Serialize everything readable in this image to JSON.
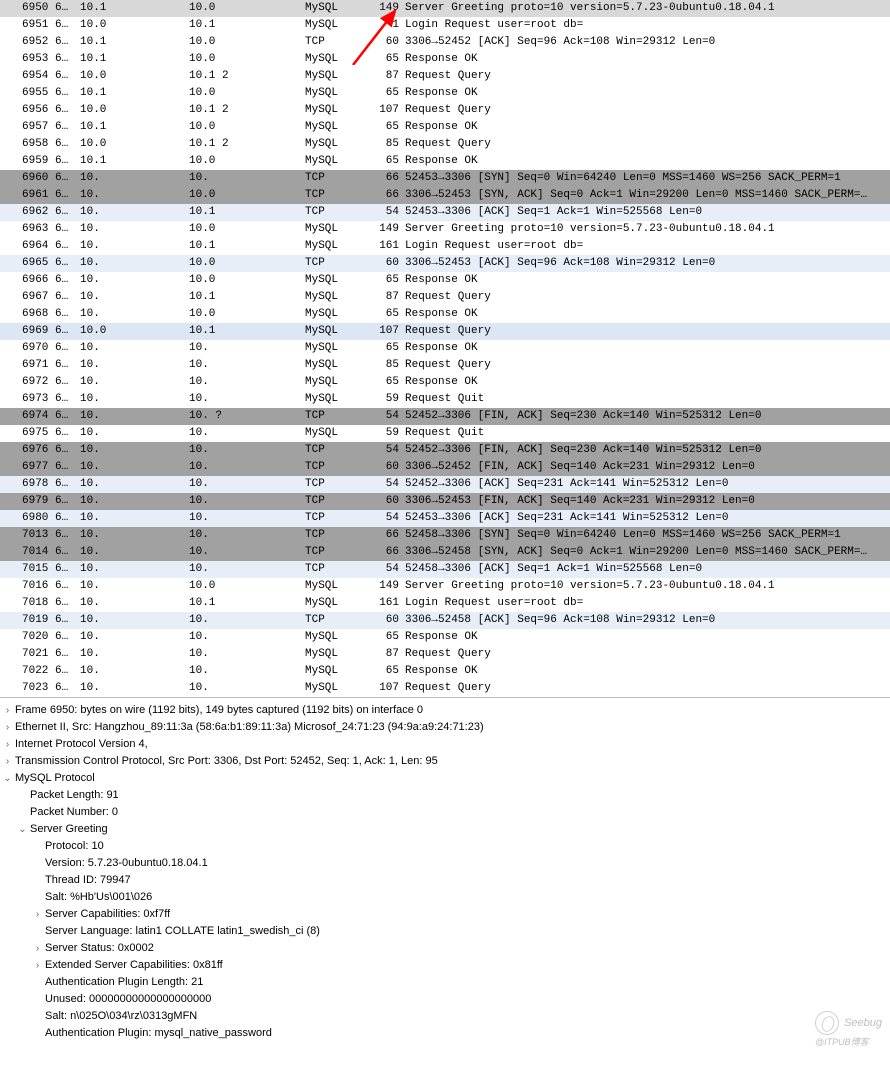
{
  "packets": [
    {
      "no": "6950",
      "time": "6…",
      "src": "10.1",
      "dst": "10.0",
      "proto": "MySQL",
      "len": "149",
      "info": "Server Greeting proto=10 version=5.7.23-0ubuntu0.18.04.1",
      "bg": "bg-sel"
    },
    {
      "no": "6951",
      "time": "6…",
      "src": "10.0",
      "dst": "10.1",
      "proto": "MySQL",
      "len": "  1",
      "info": "Login Request user=root db=",
      "bg": "bg-white"
    },
    {
      "no": "6952",
      "time": "6…",
      "src": "10.1",
      "dst": "10.0",
      "proto": "TCP",
      "len": "60",
      "info": "3306→52452 [ACK] Seq=96 Ack=108 Win=29312 Len=0",
      "bg": "bg-white"
    },
    {
      "no": "6953",
      "time": "6…",
      "src": "10.1",
      "dst": "10.0",
      "proto": "MySQL",
      "len": "65",
      "info": "Response OK",
      "bg": "bg-white"
    },
    {
      "no": "6954",
      "time": "6…",
      "src": "10.0",
      "dst": "10.1    2",
      "proto": "MySQL",
      "len": "87",
      "info": "Request Query",
      "bg": "bg-white"
    },
    {
      "no": "6955",
      "time": "6…",
      "src": "10.1",
      "dst": "10.0",
      "proto": "MySQL",
      "len": "65",
      "info": "Response OK",
      "bg": "bg-white"
    },
    {
      "no": "6956",
      "time": "6…",
      "src": "10.0",
      "dst": "10.1    2",
      "proto": "MySQL",
      "len": "107",
      "info": "Request Query",
      "bg": "bg-white"
    },
    {
      "no": "6957",
      "time": "6…",
      "src": "10.1",
      "dst": "10.0",
      "proto": "MySQL",
      "len": "65",
      "info": "Response OK",
      "bg": "bg-white"
    },
    {
      "no": "6958",
      "time": "6…",
      "src": "10.0",
      "dst": "10.1    2",
      "proto": "MySQL",
      "len": "85",
      "info": "Request Query",
      "bg": "bg-white"
    },
    {
      "no": "6959",
      "time": "6…",
      "src": "10.1",
      "dst": "10.0",
      "proto": "MySQL",
      "len": "65",
      "info": "Response OK",
      "bg": "bg-white"
    },
    {
      "no": "6960",
      "time": "6…",
      "src": "10.",
      "dst": "10.",
      "proto": "TCP",
      "len": "66",
      "info": "52453→3306 [SYN] Seq=0 Win=64240 Len=0 MSS=1460 WS=256 SACK_PERM=1",
      "bg": "bg-dark"
    },
    {
      "no": "6961",
      "time": "6…",
      "src": "10.",
      "dst": "10.0",
      "proto": "TCP",
      "len": "66",
      "info": "3306→52453 [SYN, ACK] Seq=0 Ack=1 Win=29200 Len=0 MSS=1460 SACK_PERM=…",
      "bg": "bg-dark"
    },
    {
      "no": "6962",
      "time": "6…",
      "src": "10.",
      "dst": "10.1",
      "proto": "TCP",
      "len": "54",
      "info": "52453→3306 [ACK] Seq=1 Ack=1 Win=525568 Len=0",
      "bg": "bg-light1"
    },
    {
      "no": "6963",
      "time": "6…",
      "src": "10.",
      "dst": "10.0",
      "proto": "MySQL",
      "len": "149",
      "info": "Server Greeting proto=10 version=5.7.23-0ubuntu0.18.04.1",
      "bg": "bg-white"
    },
    {
      "no": "6964",
      "time": "6…",
      "src": "10.",
      "dst": "10.1",
      "proto": "MySQL",
      "len": "161",
      "info": "Login Request user=root db=",
      "bg": "bg-white"
    },
    {
      "no": "6965",
      "time": "6…",
      "src": "10.",
      "dst": "10.0",
      "proto": "TCP",
      "len": "60",
      "info": "3306→52453 [ACK] Seq=96 Ack=108 Win=29312 Len=0",
      "bg": "bg-light1"
    },
    {
      "no": "6966",
      "time": "6…",
      "src": "10.",
      "dst": "10.0",
      "proto": "MySQL",
      "len": "65",
      "info": "Response OK",
      "bg": "bg-white"
    },
    {
      "no": "6967",
      "time": "6…",
      "src": "10.",
      "dst": "10.1",
      "proto": "MySQL",
      "len": "87",
      "info": "Request Query",
      "bg": "bg-white"
    },
    {
      "no": "6968",
      "time": "6…",
      "src": "10.",
      "dst": "10.0",
      "proto": "MySQL",
      "len": "65",
      "info": "Response OK",
      "bg": "bg-white"
    },
    {
      "no": "6969",
      "time": "6…",
      "src": "10.0",
      "dst": "10.1",
      "proto": "MySQL",
      "len": "107",
      "info": "Request Query",
      "bg": "bg-light2"
    },
    {
      "no": "6970",
      "time": "6…",
      "src": "10.",
      "dst": "10.",
      "proto": "MySQL",
      "len": "65",
      "info": "Response OK",
      "bg": "bg-white"
    },
    {
      "no": "6971",
      "time": "6…",
      "src": "10.",
      "dst": "10.",
      "proto": "MySQL",
      "len": "85",
      "info": "Request Query",
      "bg": "bg-white"
    },
    {
      "no": "6972",
      "time": "6…",
      "src": "10.",
      "dst": "10.",
      "proto": "MySQL",
      "len": "65",
      "info": "Response OK",
      "bg": "bg-white"
    },
    {
      "no": "6973",
      "time": "6…",
      "src": "10.",
      "dst": "10.",
      "proto": "MySQL",
      "len": "59",
      "info": "Request Quit",
      "bg": "bg-white"
    },
    {
      "no": "6974",
      "time": "6…",
      "src": "10.",
      "dst": "10.      ?",
      "proto": "TCP",
      "len": "54",
      "info": "52452→3306 [FIN, ACK] Seq=230 Ack=140 Win=525312 Len=0",
      "bg": "bg-dark"
    },
    {
      "no": "6975",
      "time": "6…",
      "src": "10.",
      "dst": "10.",
      "proto": "MySQL",
      "len": "59",
      "info": "Request Quit",
      "bg": "bg-white"
    },
    {
      "no": "6976",
      "time": "6…",
      "src": "10.",
      "dst": "10.",
      "proto": "TCP",
      "len": "54",
      "info": "52452→3306 [FIN, ACK] Seq=230 Ack=140 Win=525312 Len=0",
      "bg": "bg-dark"
    },
    {
      "no": "6977",
      "time": "6…",
      "src": "10.",
      "dst": "10.",
      "proto": "TCP",
      "len": "60",
      "info": "3306→52452 [FIN, ACK] Seq=140 Ack=231 Win=29312 Len=0",
      "bg": "bg-dark"
    },
    {
      "no": "6978",
      "time": "6…",
      "src": "10.",
      "dst": "10.",
      "proto": "TCP",
      "len": "54",
      "info": "52452→3306 [ACK] Seq=231 Ack=141 Win=525312 Len=0",
      "bg": "bg-light1"
    },
    {
      "no": "6979",
      "time": "6…",
      "src": "10.",
      "dst": "10.",
      "proto": "TCP",
      "len": "60",
      "info": "3306→52453 [FIN, ACK] Seq=140 Ack=231 Win=29312 Len=0",
      "bg": "bg-dark"
    },
    {
      "no": "6980",
      "time": "6…",
      "src": "10.",
      "dst": "10.",
      "proto": "TCP",
      "len": "54",
      "info": "52453→3306 [ACK] Seq=231 Ack=141 Win=525312 Len=0",
      "bg": "bg-light1"
    },
    {
      "no": "7013",
      "time": "6…",
      "src": "10.",
      "dst": "10.",
      "proto": "TCP",
      "len": "66",
      "info": "52458→3306 [SYN] Seq=0 Win=64240 Len=0 MSS=1460 WS=256 SACK_PERM=1",
      "bg": "bg-dark"
    },
    {
      "no": "7014",
      "time": "6…",
      "src": "10.",
      "dst": "10.",
      "proto": "TCP",
      "len": "66",
      "info": "3306→52458 [SYN, ACK] Seq=0 Ack=1 Win=29200 Len=0 MSS=1460 SACK_PERM=…",
      "bg": "bg-dark"
    },
    {
      "no": "7015",
      "time": "6…",
      "src": "10.",
      "dst": "10.",
      "proto": "TCP",
      "len": "54",
      "info": "52458→3306 [ACK] Seq=1 Ack=1 Win=525568 Len=0",
      "bg": "bg-light1"
    },
    {
      "no": "7016",
      "time": "6…",
      "src": "10.",
      "dst": "10.0",
      "proto": "MySQL",
      "len": "149",
      "info": "Server Greeting proto=10 version=5.7.23-0ubuntu0.18.04.1",
      "bg": "bg-white"
    },
    {
      "no": "7018",
      "time": "6…",
      "src": "10.",
      "dst": "10.1",
      "proto": "MySQL",
      "len": "161",
      "info": "Login Request user=root db=",
      "bg": "bg-white"
    },
    {
      "no": "7019",
      "time": "6…",
      "src": "10.",
      "dst": "10.",
      "proto": "TCP",
      "len": "60",
      "info": "3306→52458 [ACK] Seq=96 Ack=108 Win=29312 Len=0",
      "bg": "bg-light1"
    },
    {
      "no": "7020",
      "time": "6…",
      "src": "10.",
      "dst": "10.",
      "proto": "MySQL",
      "len": "65",
      "info": "Response OK",
      "bg": "bg-white"
    },
    {
      "no": "7021",
      "time": "6…",
      "src": "10.",
      "dst": "10.",
      "proto": "MySQL",
      "len": "87",
      "info": "Request Query",
      "bg": "bg-white"
    },
    {
      "no": "7022",
      "time": "6…",
      "src": "10.",
      "dst": "10.",
      "proto": "MySQL",
      "len": "65",
      "info": "Response OK",
      "bg": "bg-white"
    },
    {
      "no": "7023",
      "time": "6…",
      "src": "10.",
      "dst": "10.",
      "proto": "MySQL",
      "len": "107",
      "info": "Request Query",
      "bg": "bg-white"
    }
  ],
  "details": {
    "frame": "Frame 6950:    bytes on wire (1192 bits), 149 bytes captured (1192 bits) on interface 0",
    "eth": "Ethernet II, Src: Hangzhou_89:11:3a (58:6a:b1:89:11:3a)      Microsof_24:71:23 (94:9a:a9:24:71:23)",
    "ip": "Internet Protocol Version 4,",
    "tcp": "Transmission Control Protocol, Src Port: 3306, Dst Port: 52452, Seq: 1, Ack: 1, Len: 95",
    "mysql": "MySQL Protocol",
    "pkt_len": "Packet Length: 91",
    "pkt_num": "Packet Number: 0",
    "greet": "Server Greeting",
    "proto": "Protocol: 10",
    "version": "Version: 5.7.23-0ubuntu0.18.04.1",
    "thread": "Thread ID: 79947",
    "salt1": "Salt: %Hb'Us\\001\\026",
    "caps": "Server Capabilities: 0xf7ff",
    "lang": "Server Language: latin1 COLLATE latin1_swedish_ci (8)",
    "status": "Server Status: 0x0002",
    "extcaps": "Extended Server Capabilities: 0x81ff",
    "authlen": "Authentication Plugin Length: 21",
    "unused": "Unused: 00000000000000000000",
    "salt2": "Salt: n\\025O\\034\\rz\\0313gMFN",
    "authplg": "Authentication Plugin: mysql_native_password"
  },
  "watermark": {
    "brand": "Seebug",
    "sub": "@ITPUB博客"
  }
}
